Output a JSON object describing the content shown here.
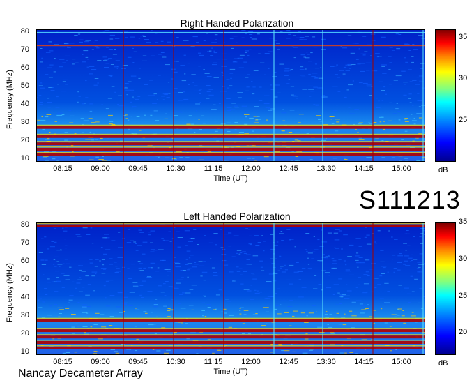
{
  "stamp": "S111213",
  "footer": "Nancay Decameter Array",
  "chart_data": [
    {
      "type": "heatmap",
      "title": "Right Handed Polarization",
      "xlabel": "Time (UT)",
      "ylabel": "Frequency (MHz)",
      "xticks": [
        "08:15",
        "09:00",
        "09:45",
        "10:30",
        "11:15",
        "12:00",
        "12:45",
        "13:30",
        "14:15",
        "15:00"
      ],
      "yticks": [
        10,
        20,
        30,
        40,
        50,
        60,
        70,
        80
      ],
      "ylim": [
        9,
        81
      ],
      "colorbar": {
        "label": "dB",
        "ticks": [
          25,
          30,
          35
        ],
        "range": [
          20,
          36
        ]
      },
      "bands_mhz": [
        {
          "freq": 27.5,
          "level": "high"
        },
        {
          "freq": 22.5,
          "level": "high"
        },
        {
          "freq": 18.5,
          "level": "high"
        },
        {
          "freq": 15.5,
          "level": "high"
        },
        {
          "freq": 12.5,
          "level": "high"
        },
        {
          "freq": 72.5,
          "level": "medium"
        },
        {
          "freq": 79.5,
          "level": "low"
        }
      ]
    },
    {
      "type": "heatmap",
      "title": "Left Handed Polarization",
      "xlabel": "Time (UT)",
      "ylabel": "Frequency (MHz)",
      "xticks": [
        "08:15",
        "09:00",
        "09:45",
        "10:30",
        "11:15",
        "12:00",
        "12:45",
        "13:30",
        "14:15",
        "15:00"
      ],
      "yticks": [
        10,
        20,
        30,
        40,
        50,
        60,
        70,
        80
      ],
      "ylim": [
        9,
        81
      ],
      "colorbar": {
        "label": "dB",
        "ticks": [
          20,
          25,
          30,
          35
        ],
        "range": [
          17,
          35
        ]
      },
      "bands_mhz": [
        {
          "freq": 27.5,
          "level": "high"
        },
        {
          "freq": 22,
          "level": "high"
        },
        {
          "freq": 18.5,
          "level": "high"
        },
        {
          "freq": 15.5,
          "level": "high"
        },
        {
          "freq": 12.5,
          "level": "high"
        },
        {
          "freq": 79.5,
          "level": "high"
        }
      ]
    }
  ]
}
